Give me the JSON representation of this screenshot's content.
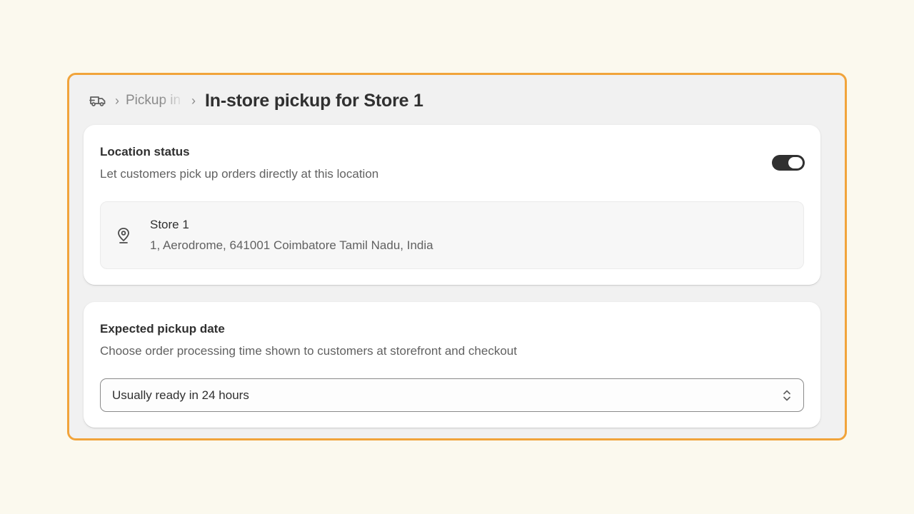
{
  "breadcrumb": {
    "icon": "delivery-truck-icon",
    "parent_label": "Pickup in store",
    "title": "In-store pickup for Store 1"
  },
  "location_status": {
    "title": "Location status",
    "description": "Let customers pick up orders directly at this location",
    "toggle_on": true,
    "store": {
      "icon": "location-pin-icon",
      "name": "Store 1",
      "address": "1, Aerodrome, 641001 Coimbatore Tamil Nadu, India"
    }
  },
  "pickup_date": {
    "title": "Expected pickup date",
    "description": "Choose order processing time shown to customers at storefront and checkout",
    "selected": "Usually ready in 24 hours",
    "icon": "select-chevrons-icon"
  },
  "colors": {
    "frame_border": "#f1a43b",
    "page_background": "#fbf9ee",
    "toggle_on": "#303030"
  }
}
